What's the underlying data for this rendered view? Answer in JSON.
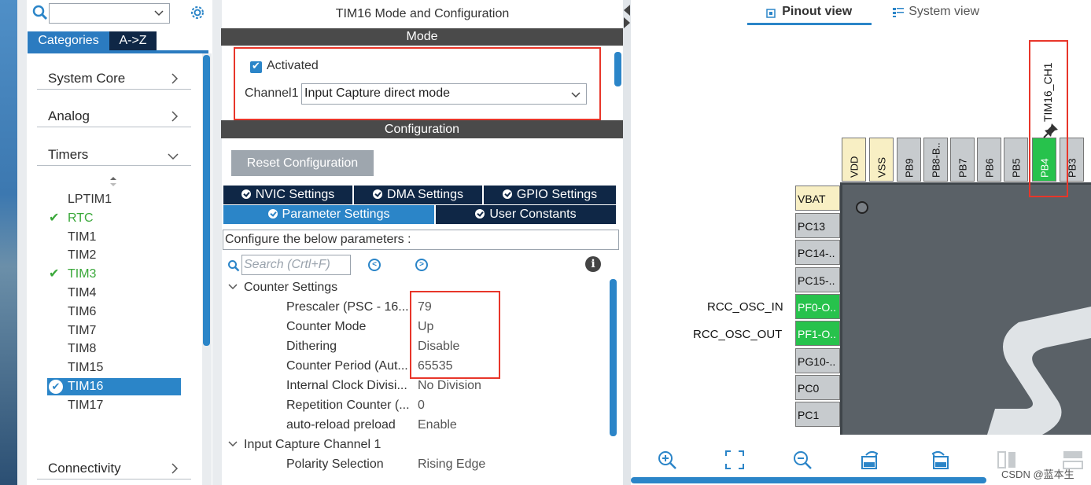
{
  "left_panel": {
    "tabs": [
      "Categories",
      "A->Z"
    ],
    "categories": [
      "System Core",
      "Analog",
      "Timers",
      "Connectivity"
    ],
    "timers": [
      {
        "label": "LPTIM1",
        "checked": false
      },
      {
        "label": "RTC",
        "checked": true
      },
      {
        "label": "TIM1",
        "checked": false
      },
      {
        "label": "TIM2",
        "checked": false
      },
      {
        "label": "TIM3",
        "checked": true
      },
      {
        "label": "TIM4",
        "checked": false
      },
      {
        "label": "TIM6",
        "checked": false
      },
      {
        "label": "TIM7",
        "checked": false
      },
      {
        "label": "TIM8",
        "checked": false
      },
      {
        "label": "TIM15",
        "checked": false
      },
      {
        "label": "TIM16",
        "checked": true,
        "selected": true
      },
      {
        "label": "TIM17",
        "checked": false
      }
    ]
  },
  "middle_panel": {
    "title": "TIM16 Mode and Configuration",
    "mode_header": "Mode",
    "activated_label": "Activated",
    "activated_checked": true,
    "channel1_label": "Channel1",
    "channel1_value": "Input Capture direct mode",
    "configuration_header": "Configuration",
    "reset_button": "Reset Configuration",
    "tabs_row1": [
      "NVIC Settings",
      "DMA Settings",
      "GPIO Settings"
    ],
    "tabs_row2": [
      "Parameter Settings",
      "User Constants"
    ],
    "active_tab": "Parameter Settings",
    "configure_text": "Configure the below parameters :",
    "search_placeholder": "Search (Crtl+F)",
    "groups": [
      {
        "name": "Counter Settings",
        "params": [
          {
            "name": "Prescaler (PSC - 16...",
            "value": "79"
          },
          {
            "name": "Counter Mode",
            "value": "Up"
          },
          {
            "name": "Dithering",
            "value": "Disable"
          },
          {
            "name": "Counter Period (Aut...",
            "value": "65535"
          },
          {
            "name": "Internal Clock Divisi...",
            "value": "No Division"
          },
          {
            "name": "Repetition Counter (...",
            "value": "0"
          },
          {
            "name": "auto-reload preload",
            "value": "Enable"
          }
        ]
      },
      {
        "name": "Input Capture Channel 1",
        "params": [
          {
            "name": "Polarity Selection",
            "value": "Rising Edge"
          }
        ]
      }
    ]
  },
  "right_panel": {
    "tabs": [
      "Pinout view",
      "System view"
    ],
    "active_tab": "Pinout view",
    "top_pins": [
      {
        "label": "VDD",
        "type": "power"
      },
      {
        "label": "VSS",
        "type": "power"
      },
      {
        "label": "PB9",
        "type": "io"
      },
      {
        "label": "PB8-B..",
        "type": "io"
      },
      {
        "label": "PB7",
        "type": "io"
      },
      {
        "label": "PB6",
        "type": "io"
      },
      {
        "label": "PB5",
        "type": "io"
      },
      {
        "label": "PB4",
        "type": "assigned"
      },
      {
        "label": "PB3",
        "type": "io"
      }
    ],
    "left_pins": [
      {
        "label": "VBAT",
        "type": "power"
      },
      {
        "label": "PC13",
        "type": "io"
      },
      {
        "label": "PC14-..",
        "type": "io"
      },
      {
        "label": "PC15-..",
        "type": "io"
      },
      {
        "label": "PF0-O..",
        "type": "assigned"
      },
      {
        "label": "PF1-O..",
        "type": "assigned"
      },
      {
        "label": "PG10-..",
        "type": "io"
      },
      {
        "label": "PC0",
        "type": "io"
      },
      {
        "label": "PC1",
        "type": "io"
      }
    ],
    "pin_signals": {
      "PB4": "TIM16_CH1",
      "PF0": "RCC_OSC_IN",
      "PF1": "RCC_OSC_OUT"
    },
    "watermark": "CSDN @蓝本生"
  },
  "colors": {
    "accent": "#2b85c8",
    "dark_navy": "#0f2746",
    "highlight_red": "#e8362a",
    "assigned_green": "#27c24c",
    "check_green": "#3aa83a"
  }
}
